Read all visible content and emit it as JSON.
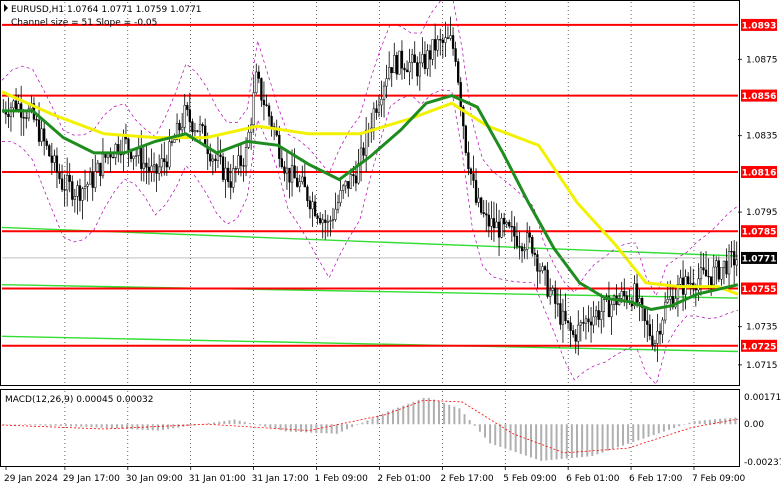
{
  "header": {
    "symbol_line": "EURUSD,H1  1.0764 1.0771 1.0759 1.0771",
    "channel_info": "Channel size = 51  Slope = -0.05"
  },
  "macd": {
    "label": "MACD(12,26,9) 0.00045 0.00032",
    "axis": [
      "0.00171",
      "0.00",
      "-0.00237"
    ]
  },
  "price_axis": {
    "ticks": [
      "1.0875",
      "1.0835",
      "1.0795",
      "1.0735",
      "1.0715"
    ]
  },
  "levels": [
    {
      "price": "1.0893",
      "color": "#ff0000"
    },
    {
      "price": "1.0856",
      "color": "#ff0000"
    },
    {
      "price": "1.0816",
      "color": "#ff0000"
    },
    {
      "price": "1.0785",
      "color": "#ff0000"
    },
    {
      "price": "1.0755",
      "color": "#ff0000"
    },
    {
      "price": "1.0725",
      "color": "#ff0000"
    }
  ],
  "current": {
    "price": "1.0771",
    "box_color": "#000000"
  },
  "time_axis": [
    "29 Jan 2024",
    "29 Jan 17:00",
    "30 Jan 09:00",
    "31 Jan 01:00",
    "31 Jan 17:00",
    "1 Feb 09:00",
    "2 Feb 01:00",
    "2 Feb 17:00",
    "5 Feb 09:00",
    "6 Feb 01:00",
    "6 Feb 17:00",
    "7 Feb 09:00"
  ],
  "colors": {
    "sma_fast": "#1e8c1e",
    "sma_slow": "#f2f200",
    "channel": "#33dd33",
    "envelope": "#b300b3",
    "level": "#ff0000"
  },
  "chart_data": {
    "type": "candlestick",
    "symbol": "EURUSD",
    "timeframe": "H1",
    "ohlc_last": {
      "open": 1.0764,
      "high": 1.0771,
      "low": 1.0759,
      "close": 1.0771
    },
    "ylim": [
      1.0705,
      1.0905
    ],
    "levels": [
      1.0893,
      1.0856,
      1.0816,
      1.0785,
      1.0755,
      1.0725
    ],
    "close_path": [
      [
        0,
        1.0848
      ],
      [
        6,
        1.0852
      ],
      [
        12,
        1.0846
      ],
      [
        18,
        1.0828
      ],
      [
        24,
        1.081
      ],
      [
        30,
        1.0806
      ],
      [
        36,
        1.0812
      ],
      [
        42,
        1.0826
      ],
      [
        48,
        1.0832
      ],
      [
        54,
        1.0824
      ],
      [
        60,
        1.0814
      ],
      [
        66,
        1.0826
      ],
      [
        72,
        1.0846
      ],
      [
        78,
        1.0838
      ],
      [
        84,
        1.0822
      ],
      [
        90,
        1.0812
      ],
      [
        96,
        1.0826
      ],
      [
        100,
        1.0864
      ],
      [
        106,
        1.0842
      ],
      [
        112,
        1.0816
      ],
      [
        118,
        1.0808
      ],
      [
        124,
        1.0796
      ],
      [
        128,
        1.0788
      ],
      [
        134,
        1.0806
      ],
      [
        140,
        1.0818
      ],
      [
        146,
        1.0848
      ],
      [
        152,
        1.0872
      ],
      [
        158,
        1.0874
      ],
      [
        164,
        1.087
      ],
      [
        170,
        1.0882
      ],
      [
        176,
        1.0884
      ],
      [
        178,
        1.0878
      ],
      [
        182,
        1.083
      ],
      [
        186,
        1.08
      ],
      [
        190,
        1.079
      ],
      [
        196,
        1.0786
      ],
      [
        202,
        1.0782
      ],
      [
        208,
        1.0778
      ],
      [
        212,
        1.0762
      ],
      [
        216,
        1.075
      ],
      [
        220,
        1.0738
      ],
      [
        224,
        1.073
      ],
      [
        230,
        1.074
      ],
      [
        236,
        1.0744
      ],
      [
        242,
        1.075
      ],
      [
        248,
        1.0752
      ],
      [
        252,
        1.0736
      ],
      [
        256,
        1.0728
      ],
      [
        260,
        1.0746
      ],
      [
        266,
        1.0756
      ],
      [
        272,
        1.076
      ],
      [
        278,
        1.0762
      ],
      [
        284,
        1.0768
      ],
      [
        288,
        1.0771
      ]
    ],
    "sma_slow_path": [
      [
        0,
        1.0858
      ],
      [
        20,
        1.0846
      ],
      [
        40,
        1.0836
      ],
      [
        60,
        1.0834
      ],
      [
        80,
        1.0834
      ],
      [
        100,
        1.084
      ],
      [
        120,
        1.0836
      ],
      [
        140,
        1.0836
      ],
      [
        160,
        1.0844
      ],
      [
        176,
        1.0852
      ],
      [
        190,
        1.084
      ],
      [
        210,
        1.083
      ],
      [
        225,
        1.08
      ],
      [
        240,
        1.0778
      ],
      [
        252,
        1.0758
      ],
      [
        265,
        1.0756
      ],
      [
        280,
        1.0756
      ],
      [
        288,
        1.0752
      ]
    ],
    "sma_fast_path": [
      [
        0,
        1.0848
      ],
      [
        12,
        1.0848
      ],
      [
        24,
        1.0834
      ],
      [
        36,
        1.0826
      ],
      [
        48,
        1.0826
      ],
      [
        60,
        1.0832
      ],
      [
        72,
        1.0836
      ],
      [
        84,
        1.0826
      ],
      [
        96,
        1.0832
      ],
      [
        108,
        1.083
      ],
      [
        120,
        1.082
      ],
      [
        132,
        1.0812
      ],
      [
        144,
        1.0824
      ],
      [
        156,
        1.0838
      ],
      [
        166,
        1.0852
      ],
      [
        176,
        1.0856
      ],
      [
        186,
        1.085
      ],
      [
        196,
        1.0826
      ],
      [
        206,
        1.08
      ],
      [
        216,
        1.0776
      ],
      [
        226,
        1.0758
      ],
      [
        236,
        1.075
      ],
      [
        246,
        1.0748
      ],
      [
        254,
        1.0744
      ],
      [
        262,
        1.0746
      ],
      [
        272,
        1.0752
      ],
      [
        288,
        1.0757
      ]
    ],
    "channel_upper": [
      [
        0,
        1.0787
      ],
      [
        288,
        1.0772
      ]
    ],
    "channel_middle": [
      [
        0,
        1.0757
      ],
      [
        288,
        1.075
      ]
    ],
    "channel_lower": [
      [
        0,
        1.073
      ],
      [
        288,
        1.0722
      ]
    ],
    "macd_hist_path": [
      [
        0,
        0.0
      ],
      [
        30,
        -0.00015
      ],
      [
        60,
        -0.0004
      ],
      [
        90,
        0.0003
      ],
      [
        110,
        -0.00045
      ],
      [
        130,
        -0.0006
      ],
      [
        150,
        0.0008
      ],
      [
        165,
        0.00171
      ],
      [
        178,
        0.001
      ],
      [
        190,
        -0.0012
      ],
      [
        210,
        -0.0023
      ],
      [
        230,
        -0.002
      ],
      [
        250,
        -0.0009
      ],
      [
        270,
        0.0002
      ],
      [
        288,
        0.00045
      ]
    ],
    "macd_signal_path": [
      [
        0,
        -5e-05
      ],
      [
        40,
        -0.0003
      ],
      [
        80,
        0.0
      ],
      [
        120,
        -0.0004
      ],
      [
        150,
        0.0006
      ],
      [
        165,
        0.0015
      ],
      [
        180,
        0.0014
      ],
      [
        200,
        -0.0006
      ],
      [
        220,
        -0.0018
      ],
      [
        245,
        -0.0015
      ],
      [
        270,
        -0.0002
      ],
      [
        288,
        0.00032
      ]
    ]
  }
}
